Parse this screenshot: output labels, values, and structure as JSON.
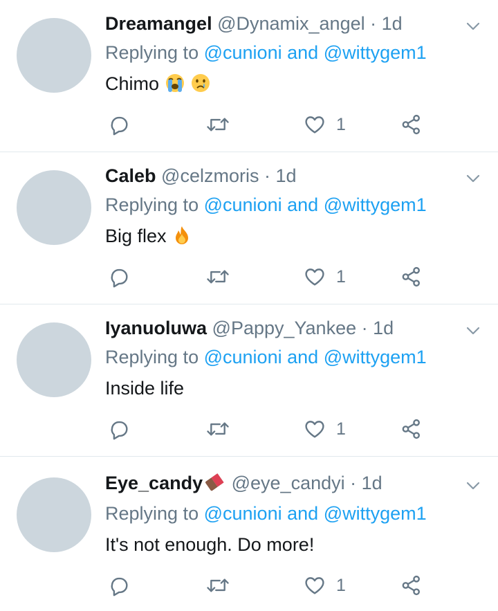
{
  "tweets": [
    {
      "name": "Dreamangel",
      "handle": "@Dynamix_angel",
      "dot": "·",
      "time": "1d",
      "replying_prefix": "Replying to",
      "reply_to_1": "@cunioni",
      "and": "and",
      "reply_to_2": "@wittygem1",
      "text": "Chimo",
      "emojis": [
        "loudly-crying-face",
        "crying-face"
      ],
      "likes": "1"
    },
    {
      "name": "Caleb",
      "handle": "@celzmoris",
      "dot": "·",
      "time": "1d",
      "replying_prefix": "Replying to",
      "reply_to_1": "@cunioni",
      "and": "and",
      "reply_to_2": "@wittygem1",
      "text": "Big flex",
      "emojis": [
        "fire"
      ],
      "likes": "1"
    },
    {
      "name": "Iyanuoluwa",
      "handle": "@Pappy_Yankee",
      "dot": "·",
      "time": "1d",
      "replying_prefix": "Replying to",
      "reply_to_1": "@cunioni",
      "and": "and",
      "reply_to_2": "@wittygem1",
      "text": "Inside life",
      "emojis": [],
      "likes": "1"
    },
    {
      "name": "Eye_candy",
      "name_emoji": "chocolate-bar",
      "handle": "@eye_candyi",
      "dot": "·",
      "time": "1d",
      "replying_prefix": "Replying to",
      "reply_to_1": "@cunioni",
      "and": "and",
      "reply_to_2": "@wittygem1",
      "text": "It's not enough. Do more!",
      "emojis": [],
      "likes": "1"
    }
  ],
  "colors": {
    "link": "#1da1f2",
    "secondary_text": "#657786",
    "primary_text": "#14171a",
    "avatar_placeholder": "#ccd6dd",
    "divider": "#e1e8ed"
  }
}
